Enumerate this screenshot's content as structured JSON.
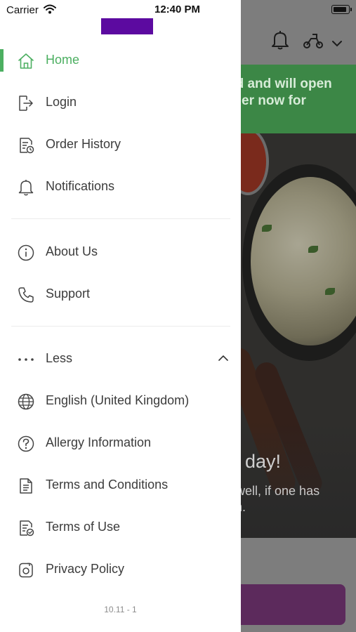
{
  "status_bar": {
    "carrier": "Carrier",
    "time": "12:40 PM"
  },
  "drawer": {
    "menu_primary": [
      {
        "label": "Home",
        "icon": "home-icon",
        "active": true
      },
      {
        "label": "Login",
        "icon": "login-icon"
      },
      {
        "label": "Order History",
        "icon": "order-history-icon"
      },
      {
        "label": "Notifications",
        "icon": "bell-icon"
      }
    ],
    "menu_secondary": [
      {
        "label": "About Us",
        "icon": "info-icon"
      },
      {
        "label": "Support",
        "icon": "phone-icon"
      }
    ],
    "menu_more": [
      {
        "label": "Less",
        "icon": "more-dots-icon"
      },
      {
        "label": "English (United Kingdom)",
        "icon": "globe-icon"
      },
      {
        "label": "Allergy Information",
        "icon": "question-circle-icon"
      },
      {
        "label": "Terms and Conditions",
        "icon": "document-icon"
      },
      {
        "label": "Terms of Use",
        "icon": "document-check-icon"
      },
      {
        "label": "Privacy Policy",
        "icon": "privacy-icon"
      }
    ],
    "version": "10.11 - 1"
  },
  "background_app": {
    "banner_text": "ed and will open\nrder now for",
    "hero_title": "day!",
    "hero_subtitle": "o well, if one has\nf in."
  },
  "colors": {
    "accent_green": "#4caf61",
    "logo_purple": "#5c0aa0",
    "banner_green": "#3c8746",
    "button_purple": "#5c2a5c"
  }
}
